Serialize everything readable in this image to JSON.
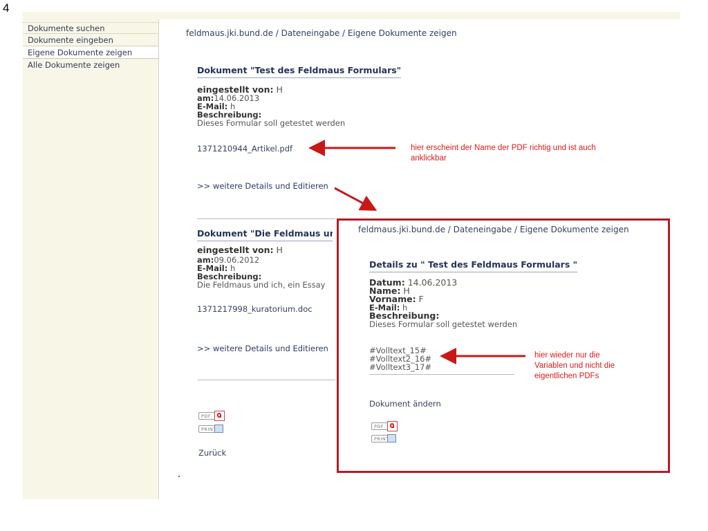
{
  "page_number": "4",
  "sidebar": {
    "items": [
      {
        "label": "Dokumente suchen"
      },
      {
        "label": "Dokumente eingeben"
      },
      {
        "label": "Eigene Dokumente zeigen"
      },
      {
        "label": "Alle Dokumente zeigen"
      }
    ],
    "active_index": 2
  },
  "breadcrumb": "feldmaus.jki.bund.de / Dateneingabe / Eigene Dokumente zeigen",
  "documents": [
    {
      "title": "Dokument \"Test des Feldmaus Formulars\"",
      "eingestellt_label": "eingestellt von:",
      "eingestellt_value": " H",
      "am_label": "am:",
      "am_value": "14.06.2013",
      "email_label": "E-Mail:",
      "email_value": " h",
      "beschreibung_label": "Beschreibung:",
      "beschreibung_value": "Dieses Formular soll getestet werden",
      "file": "1371210944_Artikel.pdf",
      "details_link": ">> weitere Details und Editieren"
    },
    {
      "title": "Dokument \"Die Feldmaus unc",
      "eingestellt_label": "eingestellt von:",
      "eingestellt_value": " H",
      "am_label": "am:",
      "am_value": "09.06.2012",
      "email_label": "E-Mail:",
      "email_value": " h",
      "beschreibung_label": "Beschreibung:",
      "beschreibung_value": "Die Feldmaus und ich, ein Essay",
      "file": "1371217998_kuratorium.doc",
      "details_link": ">> weitere Details und Editieren"
    }
  ],
  "icons": {
    "pdf_label": "PDF",
    "print_label": "PRINT"
  },
  "back_link": "Zurück",
  "overlay": {
    "breadcrumb": "feldmaus.jki.bund.de / Dateneingabe / Eigene Dokumente zeigen",
    "title": "Details zu \" Test des Feldmaus Formulars \"",
    "datum_label": "Datum:",
    "datum_value": " 14.06.2013",
    "name_label": "Name:",
    "name_value": " H",
    "vorname_label": "Vorname:",
    "vorname_value": " F",
    "email_label": "E-Mail:",
    "email_value": " h",
    "beschreibung_label": "Beschreibung:",
    "beschreibung_value": "Dieses Formular soll getestet werden",
    "variables": [
      "#Volltext_15#",
      "#Volltext2_16#",
      "#Volltext3_17#"
    ],
    "change_link": "Dokument ändern"
  },
  "annotations": {
    "note1": [
      "hier erscheint der Name der PDF richtig und ist auch",
      "anklickbar"
    ],
    "note2": [
      "hier wieder nur die",
      "Variablen und nicht die",
      "eigentlichen PDFs"
    ]
  },
  "colors": {
    "annotation": "#e01818",
    "frame": "#b51c23",
    "sidebar_bg": "#f8f6e6"
  }
}
